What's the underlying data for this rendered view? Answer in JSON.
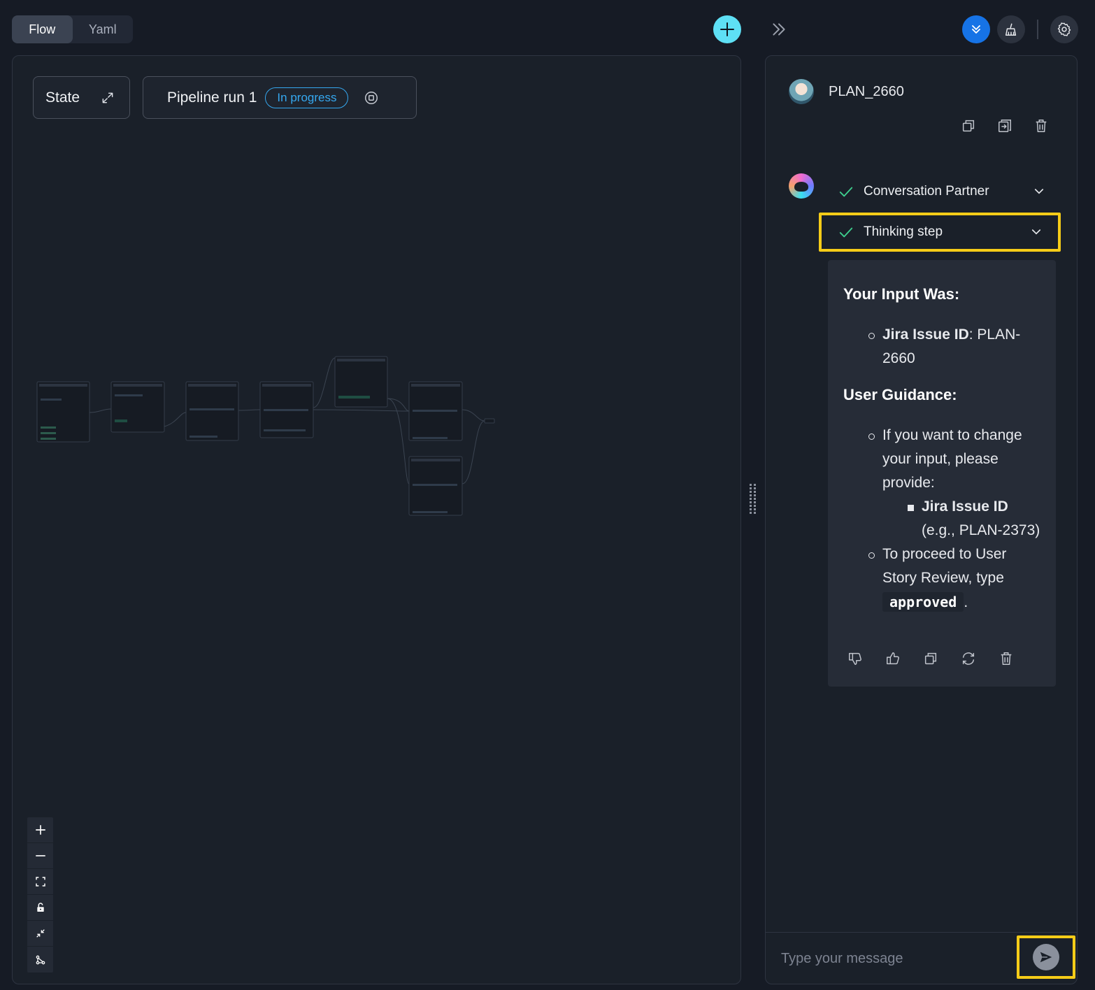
{
  "tabs": [
    {
      "label": "Flow",
      "active": true
    },
    {
      "label": "Yaml",
      "active": false
    }
  ],
  "canvas": {
    "state_label": "State",
    "run_label": "Pipeline run 1",
    "run_status": "In progress"
  },
  "chat": {
    "user_name": "PLAN_2660",
    "steps": [
      {
        "label": "Conversation Partner",
        "status": "done"
      },
      {
        "label": "Thinking step",
        "status": "done"
      }
    ],
    "message": {
      "heading_input": "Your Input Was:",
      "input_key": "Jira Issue ID",
      "input_sep": ": ",
      "input_value": "PLAN-2660",
      "heading_guidance": "User Guidance:",
      "guidance_1": "If you want to change your input, please provide:",
      "guidance_1_key": "Jira Issue ID",
      "guidance_1_example": "(e.g., PLAN-2373)",
      "guidance_2_prefix": "To proceed to User Story Review, type",
      "guidance_2_code": "approved",
      "guidance_2_suffix": "."
    },
    "composer_placeholder": "Type your message"
  },
  "colors": {
    "accent_cyan": "#5ee0f5",
    "accent_blue": "#1673e6",
    "status_blue": "#35a8f0",
    "highlight_yellow": "#f5cc18",
    "check_green": "#3ecf8e"
  }
}
